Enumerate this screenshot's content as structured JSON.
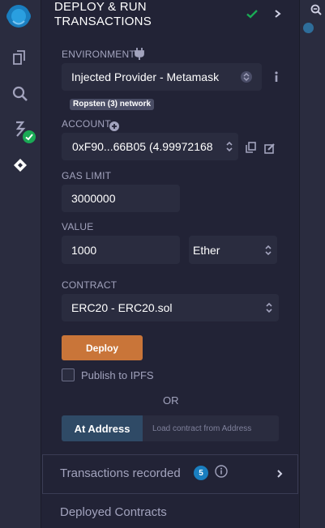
{
  "panel": {
    "title_line1": "DEPLOY & RUN",
    "title_line2": "TRANSACTIONS",
    "icons": [
      "remix-logo",
      "file-explorer-icon",
      "search-icon",
      "compiler-icon",
      "deploy-icon",
      "check-icon",
      "chevron-right-icon",
      "plug-icon",
      "info-icon",
      "plus-circle-icon",
      "copy-icon",
      "edit-icon",
      "zoom-out-icon"
    ]
  },
  "environment": {
    "label": "ENVIRONMENT",
    "value": "Injected Provider - Metamask",
    "network_badge": "Ropsten (3) network"
  },
  "account": {
    "label": "ACCOUNT",
    "value": "0xF90...66B05 (4.99972168"
  },
  "gas_limit": {
    "label": "GAS LIMIT",
    "value": "3000000"
  },
  "value": {
    "label": "VALUE",
    "amount": "1000",
    "unit": "Ether"
  },
  "contract": {
    "label": "CONTRACT",
    "value": "ERC20 - ERC20.sol"
  },
  "deploy": {
    "button_label": "Deploy",
    "publish_label": "Publish to IPFS",
    "publish_checked": false,
    "or_text": "OR"
  },
  "at_address": {
    "button_label": "At Address",
    "placeholder": "Load contract from Address"
  },
  "transactions": {
    "label": "Transactions recorded",
    "count": "5"
  },
  "deployed": {
    "label": "Deployed Contracts"
  },
  "colors": {
    "background": "#222336",
    "rail": "#2a2c3f",
    "deploy_button": "#c97539",
    "at_address_button": "#2f4a66",
    "success": "#1aaa55",
    "badge_blue": "#1a7ebf"
  }
}
